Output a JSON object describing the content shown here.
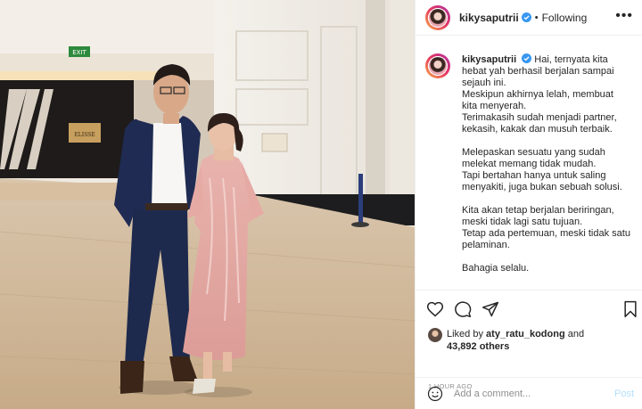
{
  "header": {
    "username": "kikysaputrii",
    "separator": "•",
    "follow_status": "Following",
    "more_label": "•••"
  },
  "caption": {
    "username": "kikysaputrii",
    "lines": [
      "Hai, ternyata kita hebat yah berhasil berjalan sampai sejauh ini.",
      "Meskipun akhirnya lelah, membuat kita menyerah.",
      "Terimakasih sudah menjadi partner, kekasih, kakak dan musuh terbaik.",
      "",
      "Melepaskan sesuatu yang sudah melekat memang tidak mudah.",
      "Tapi bertahan hanya untuk saling menyakiti, juga bukan sebuah solusi.",
      "",
      "Kita akan tetap berjalan beriringan, meski tidak lagi satu tujuan.",
      "Tetap ada pertemuan, meski tidak satu pelaminan.",
      "",
      "Bahagia selalu."
    ]
  },
  "photo": {
    "exit_sign": "EXIT",
    "wall_sign": "ELISSE"
  },
  "likes": {
    "prefix": "Liked by",
    "user": "aty_ratu_kodong",
    "connector": "and",
    "others": "43,892 others"
  },
  "timestamp": "1 HOUR AGO",
  "comment": {
    "placeholder": "Add a comment...",
    "post_label": "Post"
  },
  "icons": {
    "like": "heart-icon",
    "comment": "comment-icon",
    "share": "paper-plane-icon",
    "save": "bookmark-icon",
    "emoji": "emoji-icon",
    "verified": "verified-badge-icon"
  },
  "colors": {
    "verified": "#3897f0",
    "post_disabled": "#b2dffc",
    "muted_text": "#8e8e8e"
  }
}
